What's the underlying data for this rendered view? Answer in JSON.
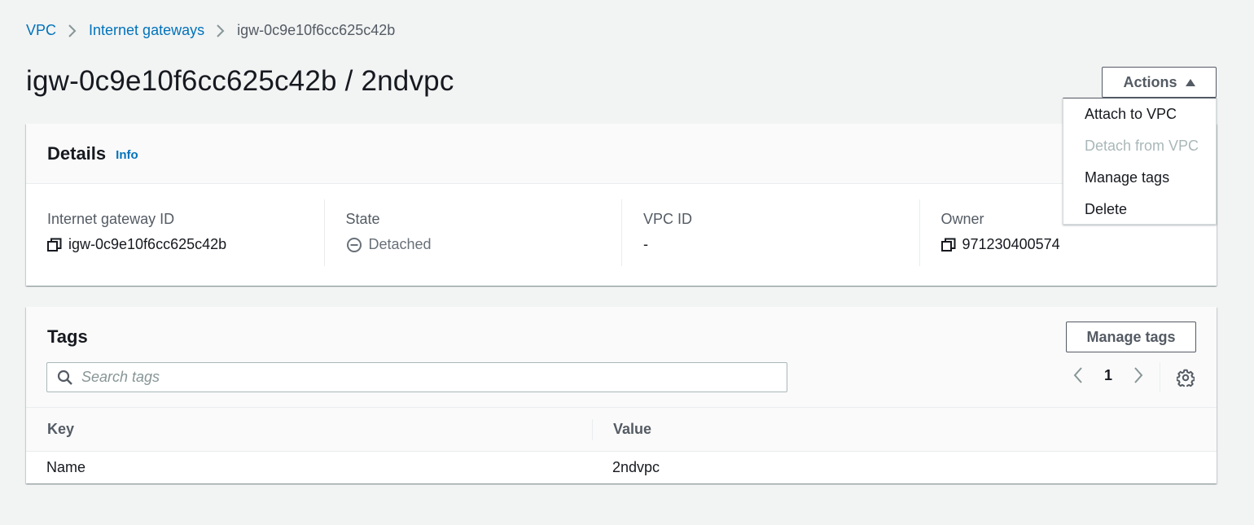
{
  "breadcrumb": {
    "items": [
      "VPC",
      "Internet gateways"
    ],
    "current": "igw-0c9e10f6cc625c42b"
  },
  "page": {
    "title": "igw-0c9e10f6cc625c42b / 2ndvpc"
  },
  "actions": {
    "label": "Actions",
    "menu": [
      {
        "label": "Attach to VPC",
        "disabled": false
      },
      {
        "label": "Detach from VPC",
        "disabled": true
      },
      {
        "label": "Manage tags",
        "disabled": false
      },
      {
        "label": "Delete",
        "disabled": false
      }
    ]
  },
  "details": {
    "heading": "Details",
    "info": "Info",
    "fields": [
      {
        "label": "Internet gateway ID",
        "value": "igw-0c9e10f6cc625c42b",
        "icon": "copy-icon"
      },
      {
        "label": "State",
        "value": "Detached",
        "icon": "stopped-status-icon"
      },
      {
        "label": "VPC ID",
        "value": "-"
      },
      {
        "label": "Owner",
        "value": "971230400574",
        "icon": "copy-icon"
      }
    ]
  },
  "tags": {
    "heading": "Tags",
    "manage_label": "Manage tags",
    "search_placeholder": "Search tags",
    "page": "1",
    "columns": {
      "key": "Key",
      "value": "Value"
    },
    "rows": [
      {
        "key": "Name",
        "value": "2ndvpc"
      }
    ]
  },
  "colors": {
    "link": "#0073bb",
    "muted": "#545b64",
    "background": "#f2f3f3"
  }
}
